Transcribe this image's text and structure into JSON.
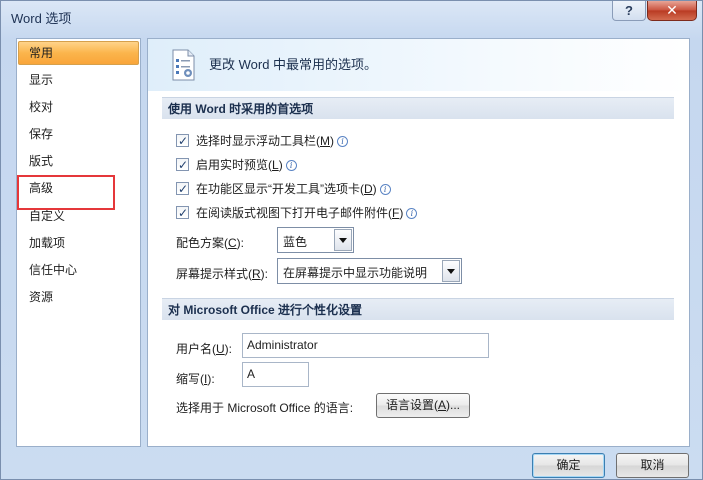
{
  "window": {
    "title": "Word 选项"
  },
  "titlebar": {
    "help_glyph": "?",
    "close_glyph": "✕"
  },
  "nav": {
    "items": [
      {
        "label": "常用",
        "selected": true
      },
      {
        "label": "显示"
      },
      {
        "label": "校对"
      },
      {
        "label": "保存"
      },
      {
        "label": "版式"
      },
      {
        "label": "高级"
      },
      {
        "label": "自定义"
      },
      {
        "label": "加载项"
      },
      {
        "label": "信任中心"
      },
      {
        "label": "资源"
      }
    ],
    "annotation_color": "#e5373a"
  },
  "header": {
    "text": "更改 Word 中最常用的选项。",
    "icon": "options-settings-icon"
  },
  "section1": {
    "title": "使用 Word 时采用的首选项",
    "checks": [
      {
        "text": "选择时显示浮动工具栏(",
        "key": "M",
        "suffix": ")",
        "checked": true
      },
      {
        "text": "启用实时预览(",
        "key": "L",
        "suffix": ")",
        "checked": true
      },
      {
        "text": "在功能区显示“开发工具”选项卡(",
        "key": "D",
        "suffix": ")",
        "checked": true
      },
      {
        "text": "在阅读版式视图下打开电子邮件附件(",
        "key": "F",
        "suffix": ")",
        "checked": true
      }
    ],
    "color_scheme": {
      "label_pre": "配色方案(",
      "key": "C",
      "label_post": "):",
      "value": "蓝色"
    },
    "screentip": {
      "label_pre": "屏幕提示样式(",
      "key": "R",
      "label_post": "):",
      "value": "在屏幕提示中显示功能说明"
    },
    "info_glyph": "i"
  },
  "section2": {
    "title": "对 Microsoft Office 进行个性化设置",
    "username": {
      "label_pre": "用户名(",
      "key": "U",
      "label_post": "):",
      "value": "Administrator"
    },
    "initials": {
      "label_pre": "缩写(",
      "key": "I",
      "label_post": "):",
      "value": "A"
    },
    "language": {
      "label": "选择用于 Microsoft Office 的语言:",
      "button_pre": "语言设置(",
      "button_key": "A",
      "button_post": ")..."
    }
  },
  "footer": {
    "ok": "确定",
    "cancel": "取消"
  },
  "colors": {
    "selected_item": "#fbb54c",
    "section_header": "#dde5f0",
    "accent": "#3c7fb1"
  }
}
